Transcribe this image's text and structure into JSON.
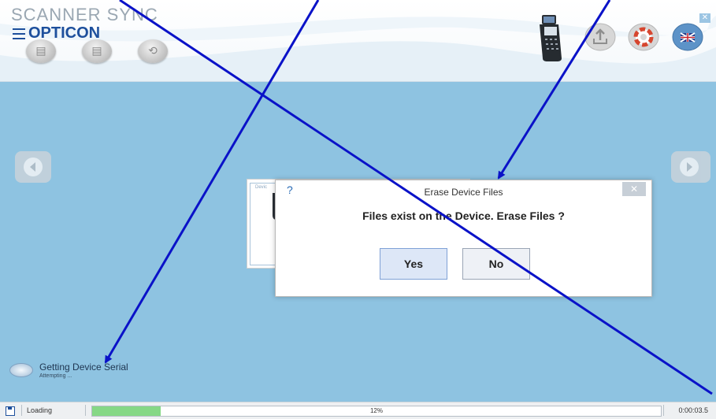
{
  "app": {
    "brand": "SCANNER SYNC",
    "logo": "OPTICON"
  },
  "header": {
    "toolbar_icons": [
      "folder-icon",
      "document-icon",
      "history-icon"
    ],
    "right_icons": [
      "device-image",
      "upload-icon",
      "help-lifebuoy-icon",
      "language-flag-uk-icon"
    ],
    "close_glyph": "✕"
  },
  "background_panel": {
    "label": "Devic"
  },
  "dialog": {
    "title": "Erase Device Files",
    "help_glyph": "?",
    "close_glyph": "✕",
    "message": "Files exist on the Device. Erase Files ?",
    "yes_label": "Yes",
    "no_label": "No"
  },
  "status": {
    "main": "Getting Device Serial",
    "sub": "Attempting ..."
  },
  "bottom_bar": {
    "loading_label": "Loading",
    "progress_percent": 12,
    "progress_text": "12%",
    "elapsed_time": "0:00:03.5"
  },
  "colors": {
    "accent_blue": "#1d4f9c",
    "main_background": "#8ec3e1",
    "annotation_arrow": "#0a12c8",
    "progress_fill": "#86d886"
  }
}
